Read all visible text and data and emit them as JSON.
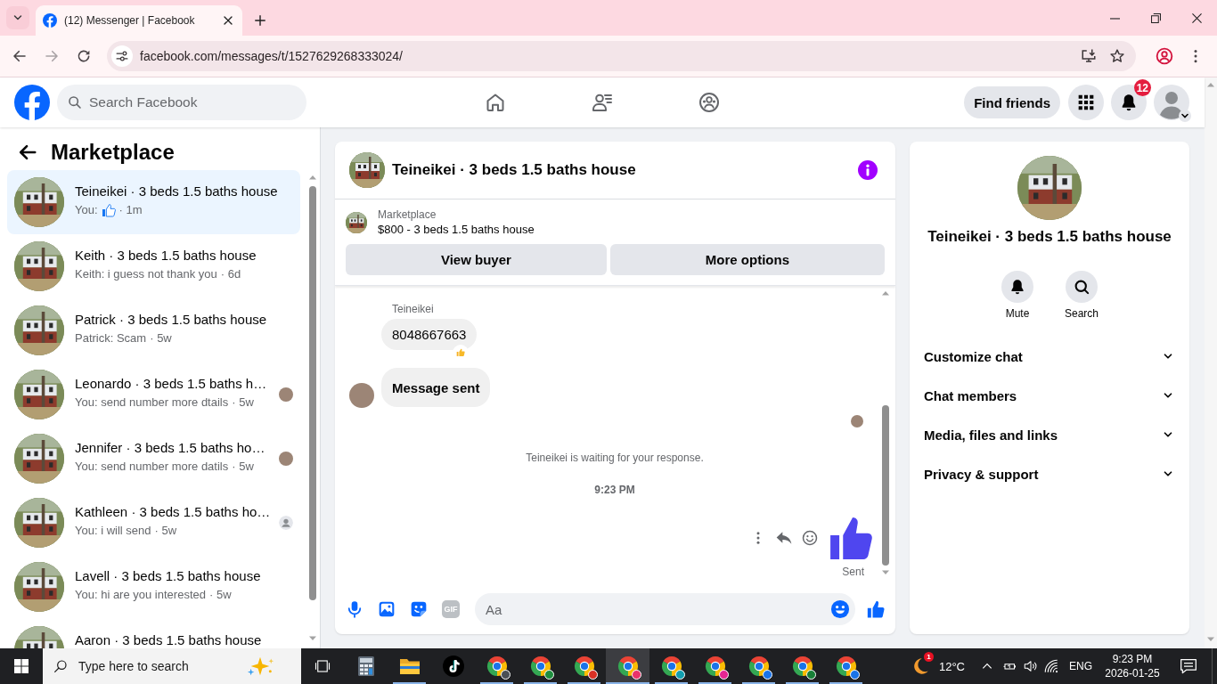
{
  "browser": {
    "tab": {
      "title": "(12) Messenger | Facebook"
    },
    "url": "facebook.com/messages/t/1527629268333024/"
  },
  "header": {
    "search": {
      "placeholder": "Search Facebook"
    },
    "nav": [
      {
        "kind": "home"
      },
      {
        "kind": "friends"
      },
      {
        "kind": "groups"
      }
    ],
    "find_friends": "Find friends",
    "notifications": "12"
  },
  "sidebar": {
    "title": "Marketplace",
    "conversations": [
      {
        "name": "Teineikei · 3 beds 1.5 baths house",
        "preview": "You:",
        "sticker": {
          "kind": "like"
        },
        "time": "· 1m",
        "selected": true
      },
      {
        "name": "Keith · 3 beds 1.5 baths house",
        "preview": "Keith: i guess not thank you",
        "time": "· 6d",
        "selected": false
      },
      {
        "name": "Patrick · 3 beds 1.5 baths house",
        "preview": "Patrick: Scam",
        "time": "· 5w",
        "selected": false
      },
      {
        "name": "Leonardo · 3 beds 1.5 baths h…",
        "preview": "You: send number more dtails",
        "time": "· 5w",
        "selected": false,
        "seen_by": {
          "kind": "photo"
        }
      },
      {
        "name": "Jennifer · 3 beds 1.5 baths ho…",
        "preview": "You: send number more datils",
        "time": "· 5w",
        "selected": false,
        "seen_by": {
          "kind": "photo"
        }
      },
      {
        "name": "Kathleen · 3 beds 1.5 baths ho…",
        "preview": "You: i will send",
        "time": "· 5w",
        "selected": false,
        "seen_by": {
          "kind": "silhouette"
        }
      },
      {
        "name": "Lavell · 3 beds 1.5 baths house",
        "preview": "You: hi are you interested",
        "time": "· 5w",
        "selected": false
      },
      {
        "name": "Aaron · 3 beds 1.5 baths house",
        "selected": false
      }
    ]
  },
  "chat": {
    "title": "Teineikei · 3 beds 1.5 baths house",
    "listing": {
      "label": "Marketplace",
      "title": "$800 - 3 beds 1.5 baths house"
    },
    "actions": [
      "View buyer",
      "More options"
    ],
    "messages": [
      {
        "kind": "received",
        "sender": "Teineikei",
        "text": "8048667663",
        "reaction": {
          "kind": "thumbs_up"
        },
        "bold": false,
        "avatar": false
      },
      {
        "kind": "received",
        "text": "Message sent",
        "bold": true,
        "avatar": true
      }
    ],
    "seen_by": {
      "kind": "photo"
    },
    "status": "Teineikei is waiting for your response.",
    "timestamp": "9:23 PM",
    "sent": {
      "kind": "like",
      "status": "Sent"
    },
    "composer": {
      "gif": "GIF",
      "placeholder": "Aa"
    }
  },
  "details": {
    "name": "Teineikei · 3 beds 1.5 baths house",
    "actions": [
      {
        "kind": "mute",
        "label": "Mute"
      },
      {
        "kind": "search",
        "label": "Search"
      }
    ],
    "sections": [
      {
        "label": "Customize chat",
        "expanded": false
      },
      {
        "label": "Chat members",
        "expanded": false
      },
      {
        "label": "Media, files and links",
        "expanded": false
      },
      {
        "label": "Privacy & support",
        "expanded": false
      }
    ]
  },
  "taskbar": {
    "search": {
      "placeholder": "Type here to search"
    },
    "apps": [
      {
        "kind": "calculator",
        "running": false,
        "selected": false
      },
      {
        "kind": "files",
        "running": true,
        "selected": false
      },
      {
        "kind": "tiktok",
        "running": false,
        "selected": false
      },
      {
        "kind": "chrome",
        "color": "#4a4f55",
        "running": true,
        "selected": false
      },
      {
        "kind": "chrome",
        "color": "#1e8e3e",
        "running": true,
        "selected": false
      },
      {
        "kind": "chrome",
        "color": "#d93025",
        "running": true,
        "selected": false
      },
      {
        "kind": "chrome",
        "color": "#e8336a",
        "running": true,
        "selected": true
      },
      {
        "kind": "chrome",
        "color": "#129eaf",
        "running": true,
        "selected": false
      },
      {
        "kind": "chrome",
        "color": "#e52592",
        "running": true,
        "selected": false
      },
      {
        "kind": "chrome",
        "color": "#1a73e8",
        "running": true,
        "selected": false
      },
      {
        "kind": "chrome",
        "color": "#188038",
        "running": true,
        "selected": false
      },
      {
        "kind": "chrome",
        "color": "#1a73e8",
        "running": true,
        "selected": false
      }
    ],
    "weather": {
      "badge": "1",
      "temperature": "12°C"
    },
    "language": "ENG",
    "time": "9:23 PM",
    "date": "2026-01-25"
  }
}
